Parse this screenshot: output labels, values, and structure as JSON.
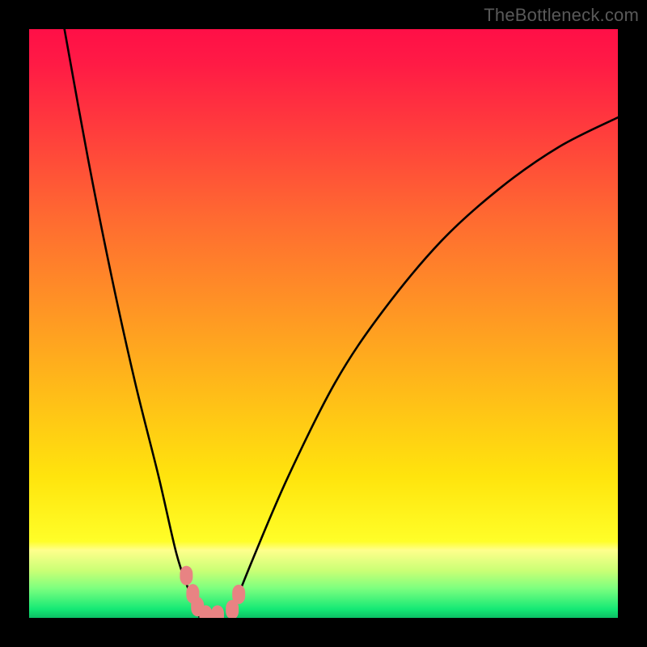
{
  "watermark": "TheBottleneck.com",
  "chart_data": {
    "type": "line",
    "title": "",
    "xlabel": "",
    "ylabel": "",
    "xlim": [
      0,
      100
    ],
    "ylim": [
      0,
      100
    ],
    "grid": false,
    "left_curve": {
      "x": [
        6,
        10,
        14,
        18,
        22,
        25,
        27,
        29
      ],
      "y": [
        100,
        78,
        58,
        40,
        24,
        11,
        5,
        0
      ]
    },
    "right_curve": {
      "x": [
        34,
        38,
        44,
        52,
        60,
        70,
        80,
        90,
        100
      ],
      "y": [
        0,
        10,
        24,
        40,
        52,
        64,
        73,
        80,
        85
      ]
    },
    "green_band": {
      "y_range": [
        0,
        8
      ]
    },
    "yellow_band": {
      "y_range": [
        8,
        12.5
      ]
    },
    "markers": [
      {
        "x": 26.7,
        "y": 7.2
      },
      {
        "x": 27.8,
        "y": 4.1
      },
      {
        "x": 28.6,
        "y": 1.9
      },
      {
        "x": 30.0,
        "y": 0.5
      },
      {
        "x": 32.0,
        "y": 0.5
      },
      {
        "x": 34.5,
        "y": 1.4
      },
      {
        "x": 35.6,
        "y": 4.0
      }
    ],
    "gradient_stops": [
      {
        "pos": 0.0,
        "color": "#ff0f47"
      },
      {
        "pos": 0.06,
        "color": "#ff1b45"
      },
      {
        "pos": 0.18,
        "color": "#ff3f3c"
      },
      {
        "pos": 0.32,
        "color": "#ff6a31"
      },
      {
        "pos": 0.48,
        "color": "#ff9624"
      },
      {
        "pos": 0.62,
        "color": "#ffbd18"
      },
      {
        "pos": 0.76,
        "color": "#ffe40d"
      },
      {
        "pos": 0.87,
        "color": "#fffe28"
      },
      {
        "pos": 0.885,
        "color": "#ffff8c"
      },
      {
        "pos": 0.92,
        "color": "#c9ff75"
      },
      {
        "pos": 0.95,
        "color": "#7cff7f"
      },
      {
        "pos": 0.985,
        "color": "#15e975"
      },
      {
        "pos": 1.0,
        "color": "#0cc065"
      }
    ],
    "marker_color": "#e88383",
    "curve_color": "#000000"
  }
}
